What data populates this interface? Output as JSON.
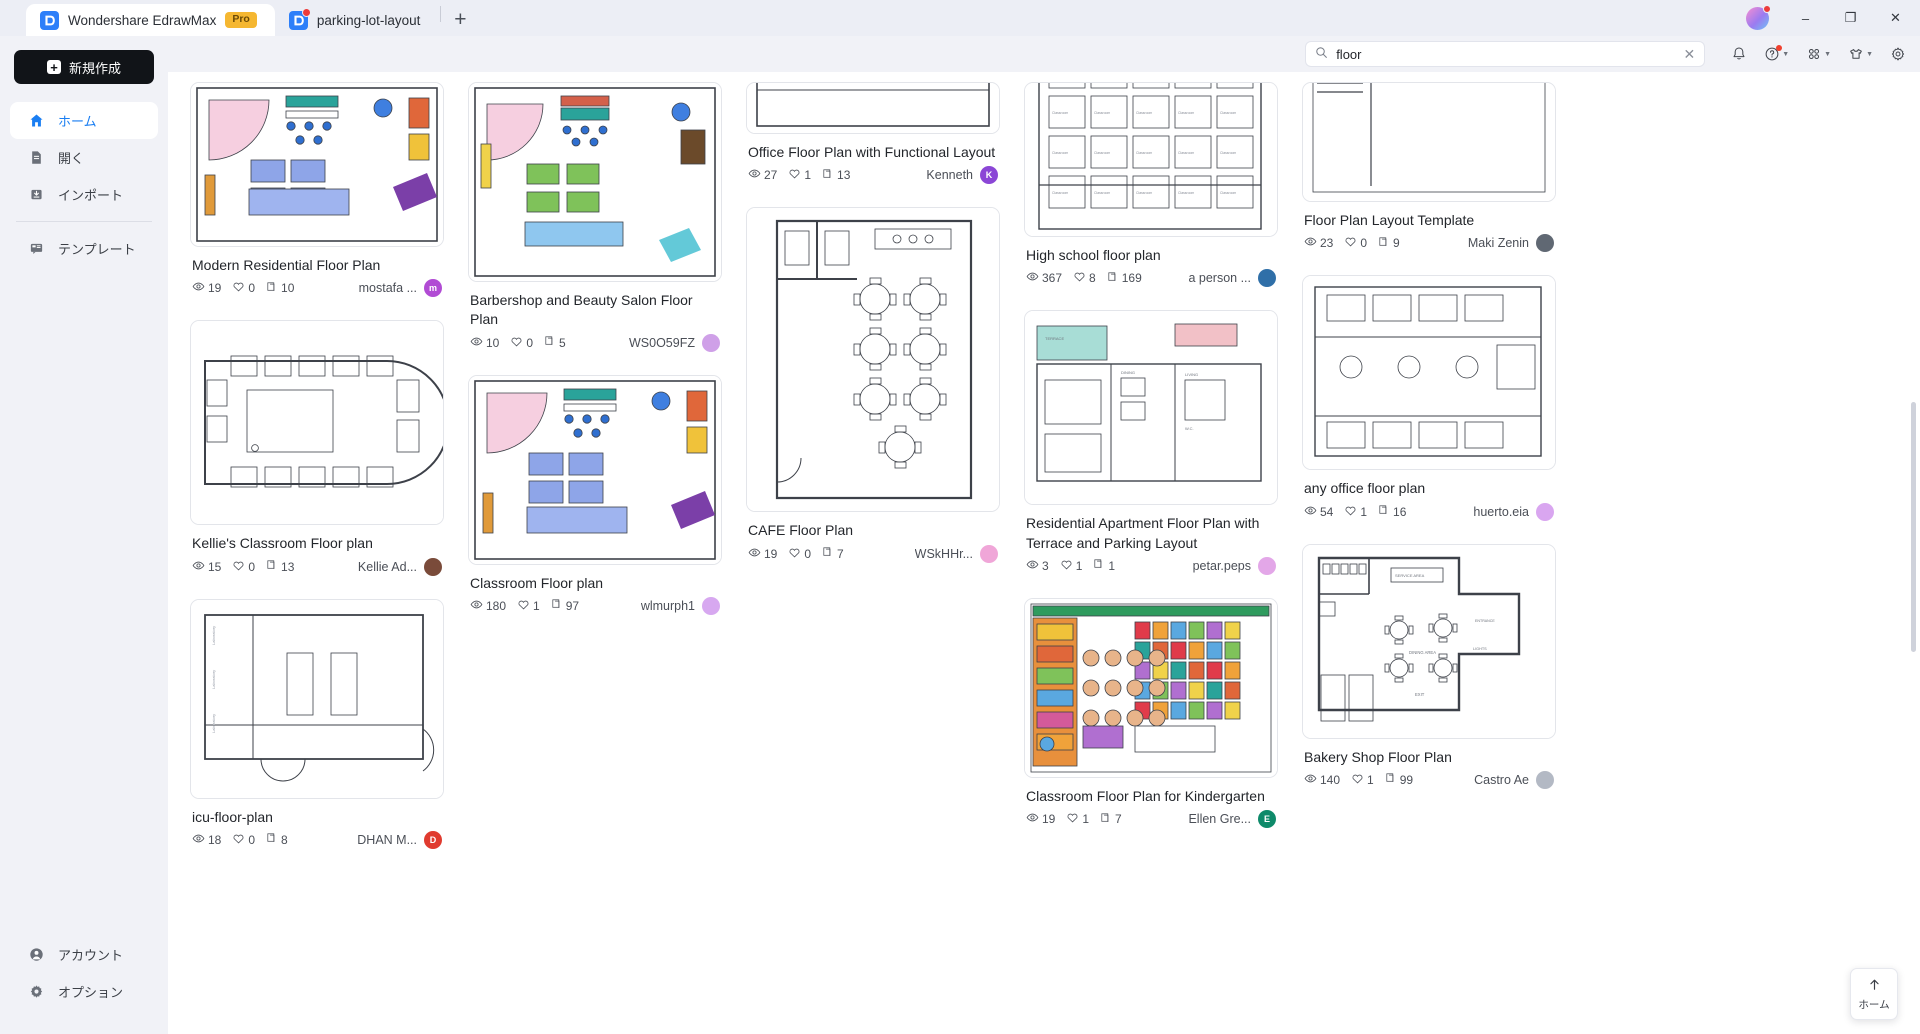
{
  "window": {
    "app_tab": "Wondershare EdrawMax",
    "pro_badge": "Pro",
    "doc_tab": "parking-lot-layout",
    "new_tab": "+",
    "minimize": "–",
    "maximize": "❐",
    "close": "✕"
  },
  "sidebar": {
    "new_button": "新規作成",
    "items": [
      {
        "label": "ホーム",
        "icon": "home-icon",
        "active": true
      },
      {
        "label": "開く",
        "icon": "file-open-icon",
        "active": false
      },
      {
        "label": "インポート",
        "icon": "import-icon",
        "active": false
      },
      {
        "label": "テンプレート",
        "icon": "template-icon",
        "active": false
      }
    ],
    "bottom_items": [
      {
        "label": "アカウント",
        "icon": "account-icon"
      },
      {
        "label": "オプション",
        "icon": "gear-icon"
      }
    ]
  },
  "toolbar": {
    "search_value": "floor",
    "search_placeholder": "",
    "clear_label": "✕",
    "icons": [
      "bell-icon",
      "help-icon",
      "apps-grid-icon",
      "theme-shirt-icon",
      "gear-icon"
    ]
  },
  "fab": {
    "label": "ホーム",
    "icon": "arrow-up-icon"
  },
  "cards": [
    {
      "title": "Modern Residential Floor Plan",
      "views": "19",
      "likes": "0",
      "copies": "10",
      "author": "mostafa ...",
      "avatar_letter": "m",
      "avatar_color": "#b14bd4",
      "thumb": "classroom-colored",
      "thumb_h": 165
    },
    {
      "title": "Kellie's Classroom Floor plan",
      "views": "15",
      "likes": "0",
      "copies": "13",
      "author": "Kellie Ad...",
      "avatar_letter": "",
      "avatar_color": "#7a4b3a",
      "thumb": "icu-plan",
      "thumb_h": 205
    },
    {
      "title": "icu-floor-plan",
      "views": "18",
      "likes": "0",
      "copies": "8",
      "author": "DHAN M...",
      "avatar_letter": "D",
      "avatar_color": "#e03b2f",
      "thumb": "simple-rooms",
      "thumb_h": 200
    },
    {
      "title": "Barbershop and Beauty Salon Floor Plan",
      "views": "10",
      "likes": "0",
      "copies": "5",
      "author": "WS0O59FZ",
      "avatar_letter": "",
      "avatar_color": "#cfa0e8",
      "thumb": "barbershop",
      "thumb_h": 200
    },
    {
      "title": "Classroom Floor plan",
      "views": "180",
      "likes": "1",
      "copies": "97",
      "author": "wlmurph1",
      "avatar_letter": "",
      "avatar_color": "#d7a8f0",
      "thumb": "classroom-colored",
      "thumb_h": 190
    },
    {
      "title": "Office Floor Plan with Functional Layout",
      "views": "27",
      "likes": "1",
      "copies": "13",
      "author": "Kenneth",
      "avatar_letter": "K",
      "avatar_color": "#8b46d6",
      "thumb": "office-partial",
      "thumb_h": 52
    },
    {
      "title": "CAFE Floor Plan",
      "views": "19",
      "likes": "0",
      "copies": "7",
      "author": "WSkHHr...",
      "avatar_letter": "",
      "avatar_color": "#f0a6d8",
      "thumb": "cafe",
      "thumb_h": 305
    },
    {
      "title": "High school floor plan",
      "views": "367",
      "likes": "8",
      "copies": "169",
      "author": "a person ...",
      "avatar_letter": "",
      "avatar_color": "#2f6fa8",
      "thumb": "highschool",
      "thumb_h": 155
    },
    {
      "title": "Residential Apartment Floor Plan with Terrace and Parking Layout",
      "views": "3",
      "likes": "1",
      "copies": "1",
      "author": "petar.peps",
      "avatar_letter": "",
      "avatar_color": "#e3a7e8",
      "thumb": "apartment",
      "thumb_h": 195
    },
    {
      "title": "Classroom Floor Plan for Kindergarten",
      "views": "19",
      "likes": "1",
      "copies": "7",
      "author": "Ellen Gre...",
      "avatar_letter": "E",
      "avatar_color": "#0e8a6a",
      "thumb": "kindergarten",
      "thumb_h": 180
    },
    {
      "title": "Floor Plan Layout Template",
      "views": "23",
      "likes": "0",
      "copies": "9",
      "author": "Maki Zenin",
      "avatar_letter": "",
      "avatar_color": "#606873",
      "thumb": "layout-template",
      "thumb_h": 120
    },
    {
      "title": "any office floor plan",
      "views": "54",
      "likes": "1",
      "copies": "16",
      "author": "huerto.eia",
      "avatar_letter": "",
      "avatar_color": "#d9a6f0",
      "thumb": "any-office",
      "thumb_h": 195
    },
    {
      "title": "Bakery Shop Floor Plan",
      "views": "140",
      "likes": "1",
      "copies": "99",
      "author": "Castro Ae",
      "avatar_letter": "",
      "avatar_color": "#b3b9c4",
      "thumb": "bakery",
      "thumb_h": 195
    }
  ],
  "columns": [
    [
      0,
      1,
      2
    ],
    [
      3,
      4
    ],
    [
      5,
      6
    ],
    [
      7,
      8,
      9
    ],
    [
      10,
      11,
      12
    ]
  ],
  "colors": {
    "accent": "#1a7ef2",
    "sidebar_bg": "#f1f2f7",
    "new_btn_bg": "#111418"
  }
}
